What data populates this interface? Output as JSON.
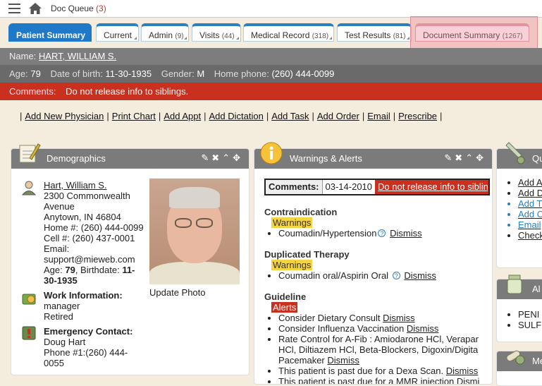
{
  "topbar": {
    "title": "Doc Queue",
    "count": "(3)"
  },
  "tabs": [
    {
      "label": "Patient Summary",
      "count": ""
    },
    {
      "label": "Current",
      "count": ""
    },
    {
      "label": "Admin",
      "count": "(9)"
    },
    {
      "label": "Visits",
      "count": "(44)"
    },
    {
      "label": "Medical Record",
      "count": "(318)"
    },
    {
      "label": "Test Results",
      "count": "(81)"
    },
    {
      "label": "Document Summary",
      "count": "(1267)"
    }
  ],
  "patient": {
    "name_label": "Name:",
    "name": "HART, WILLIAM S.",
    "age_label": "Age:",
    "age": "79",
    "dob_label": "Date of birth:",
    "dob": "11-30-1935",
    "gender_label": "Gender:",
    "gender": "M",
    "phone_label": "Home phone:",
    "phone": "(260) 444-0099",
    "comments_label": "Comments:",
    "comments": "Do not release info to siblings."
  },
  "actions": [
    "Add New Physician",
    "Print Chart",
    "Add Appt",
    "Add Dictation",
    "Add Task",
    "Add Order",
    "Email",
    "Prescribe"
  ],
  "demographics": {
    "title": "Demographics",
    "name_link": "Hart, William S.",
    "addr1": "2300 Commonwealth",
    "addr2": "Avenue",
    "addr3": "Anytown, IN 46804",
    "home": "Home #: (260) 444-0099",
    "cell": "Cell #: (260) 437-0001",
    "email_label": "Email:",
    "email": "support@mieweb.com",
    "age_line_prefix": "Age: ",
    "age": "79",
    "birth_prefix": ", Birthdate: ",
    "birth": "11-",
    "birth2": "30-1935",
    "update_photo": "Update Photo",
    "work_title": "Work Information:",
    "work1": "manager",
    "work2": "Retired",
    "emerg_title": "Emergency Contact:",
    "emerg_name": "Doug Hart",
    "emerg_phone1": "Phone #1:(260) 444-",
    "emerg_phone2": "0055"
  },
  "warnings": {
    "title": "Warnings & Alerts",
    "comments_label": "Comments:",
    "comments_date": "03-14-2010",
    "comments_text": "Do not release info to siblings",
    "contra_title": "Contraindication",
    "contra_tag": "Warnings",
    "contra_item": "Coumadin/Hypertension",
    "dismiss": "Dismiss",
    "dup_title": "Duplicated Therapy",
    "dup_tag": "Warnings",
    "dup_item": "Coumadin oral/Aspirin Oral",
    "guide_title": "Guideline",
    "guide_tag": "Alerts",
    "g1": "Consider Dietary Consult",
    "g2": "Consider Influenza Vaccination",
    "g3a": "Rate Control for A-Fib : Amiodarone HCl, Verapar",
    "g3b": "HCl, Diltiazem HCl, Beta-Blockers, Digoxin/Digita",
    "g3c": "Pacemaker",
    "g4": "This patient is past due for a Dexa Scan.",
    "g5": "This patient is past due for a MMR injection",
    "g5d": "Dismi"
  },
  "quick": {
    "title": "Qu",
    "items": [
      "Add A",
      "Add D",
      "Add T",
      "Add O",
      "Email",
      "Check"
    ]
  },
  "allergies": {
    "title": "Al",
    "items": [
      "PENI",
      "SULF"
    ]
  },
  "meds": {
    "title": "Me"
  },
  "colors": {
    "accent": "#1f78c8",
    "alert": "#c9301f",
    "warning": "#f5d442",
    "header": "#7b7b7b"
  }
}
